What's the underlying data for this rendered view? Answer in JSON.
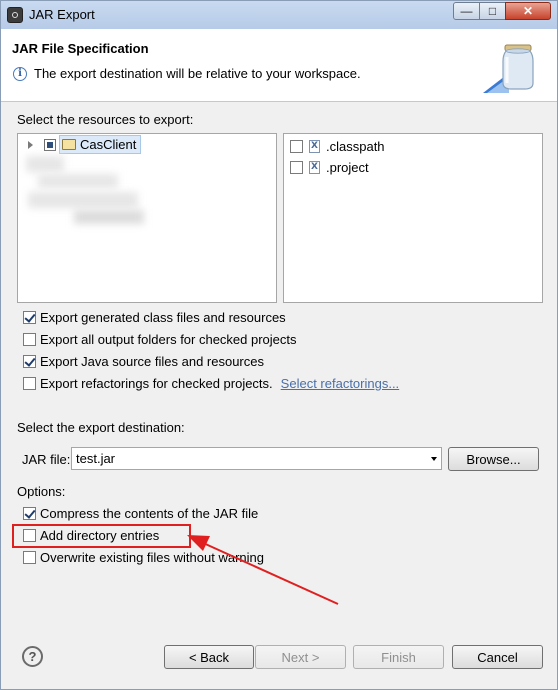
{
  "window": {
    "title": "JAR Export",
    "controls": {
      "minimize": "—",
      "maximize": "□",
      "close": "✕"
    }
  },
  "header": {
    "title": "JAR File Specification",
    "message": "The export destination will be relative to your workspace."
  },
  "resources": {
    "label": "Select the resources to export:",
    "project": {
      "name": "CasClient",
      "state": "partial"
    },
    "files": [
      {
        "name": ".classpath",
        "checked": false,
        "icon": "x-file-icon"
      },
      {
        "name": ".project",
        "checked": false,
        "icon": "x-file-icon"
      }
    ]
  },
  "export_options": [
    {
      "label": "Export generated class files and resources",
      "checked": true
    },
    {
      "label": "Export all output folders for checked projects",
      "checked": false
    },
    {
      "label": "Export Java source files and resources",
      "checked": true
    },
    {
      "label": "Export refactorings for checked projects.",
      "checked": false,
      "link": "Select refactorings..."
    }
  ],
  "destination": {
    "label": "Select the export destination:",
    "jar_label": "JAR file:",
    "jar_value": "test.jar",
    "browse": "Browse..."
  },
  "options": {
    "label": "Options:",
    "items": [
      {
        "label": "Compress the contents of the JAR file",
        "checked": true
      },
      {
        "label": "Add directory entries",
        "checked": false
      },
      {
        "label": "Overwrite existing files without warning",
        "checked": false
      }
    ]
  },
  "footer": {
    "help_icon": "question-icon",
    "back": "< Back",
    "next": "Next >",
    "finish": "Finish",
    "cancel": "Cancel"
  },
  "annotation": {
    "color": "#e02020"
  }
}
